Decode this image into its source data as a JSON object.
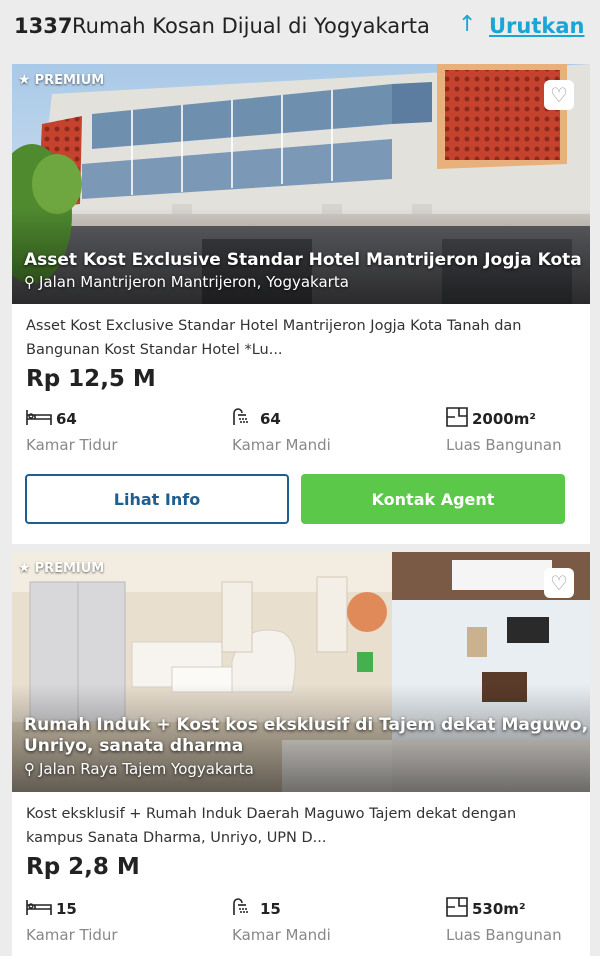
{
  "header": {
    "count": "1337",
    "title": "Rumah Kosan Dijual di Yogyakarta",
    "sort_icon": "sort-up-arrow-icon",
    "sort_label": "Urutkan"
  },
  "listings": [
    {
      "badge": "PREMIUM",
      "overlay_title": "Asset Kost Exclusive Standar Hotel Mantrijeron Jogja Kota",
      "location": "Jalan Mantrijeron Mantrijeron, Yogyakarta",
      "description_line1": "Asset Kost Exclusive Standar Hotel Mantrijeron Jogja Kota Tanah dan",
      "description_line2": "Bangunan Kost Standar Hotel *Lu...",
      "price": "Rp 12,5 M",
      "bedrooms": "64",
      "bedrooms_label": "Kamar Tidur",
      "bathrooms": "64",
      "bathrooms_label": "Kamar Mandi",
      "area": "2000m²",
      "area_label": "Luas Bangunan",
      "info_button": "Lihat Info",
      "agent_button": "Kontak Agent"
    },
    {
      "badge": "PREMIUM",
      "overlay_title_line1": "Rumah Induk + Kost kos eksklusif di Tajem dekat Maguwo,",
      "overlay_title_line2": "Unriyo, sanata dharma",
      "location": "Jalan Raya Tajem Yogyakarta",
      "description_line1": "Kost eksklusif + Rumah Induk Daerah Maguwo Tajem dekat dengan",
      "description_line2": "kampus Sanata Dharma, Unriyo, UPN   D...",
      "price": "Rp 2,8 M",
      "bedrooms": "15",
      "bedrooms_label": "Kamar Tidur",
      "bathrooms": "15",
      "bathrooms_label": "Kamar Mandi",
      "area": "530m²",
      "area_label": "Luas Bangunan"
    }
  ],
  "colors": {
    "accent_blue": "#1aa5d6",
    "button_outline": "#1f5e8e",
    "button_green": "#5cc84a"
  }
}
